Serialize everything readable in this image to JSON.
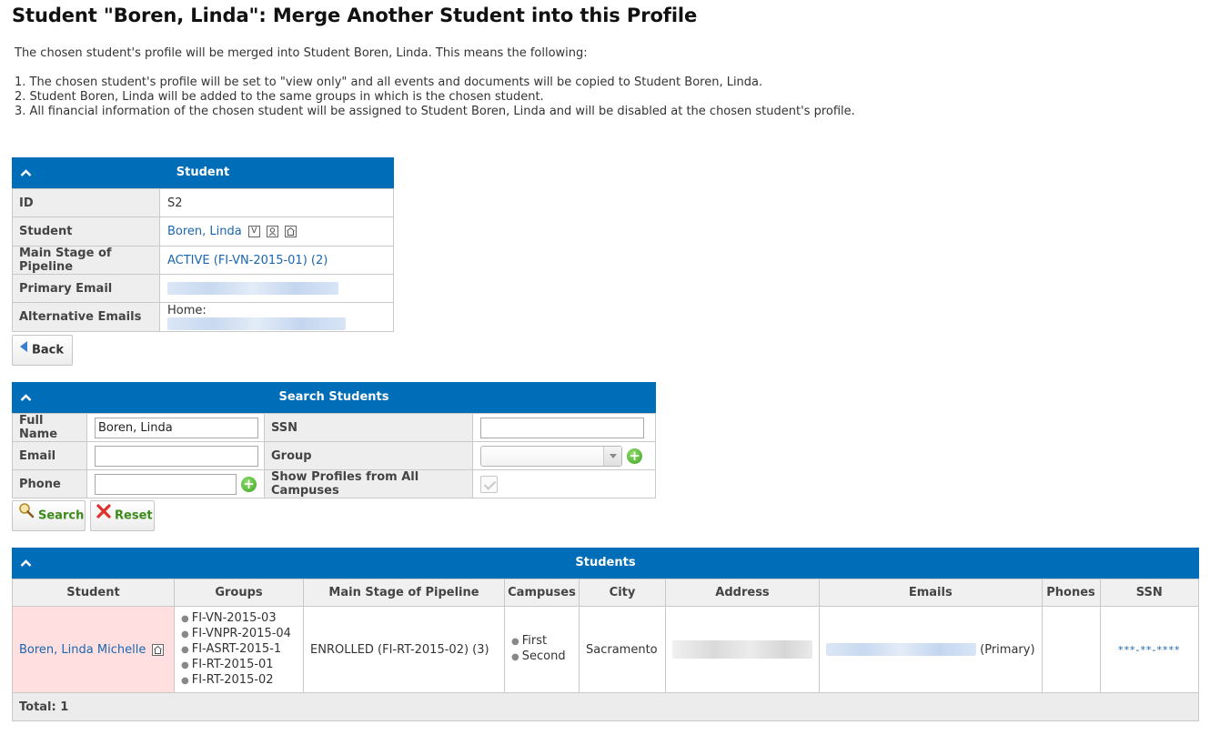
{
  "page_title": "Student \"Boren, Linda\": Merge Another Student into this Profile",
  "intro": {
    "lead": "The chosen student's profile will be merged into Student Boren, Linda. This means the following:",
    "points": [
      "1. The chosen student's profile will be set to \"view only\" and all events and documents will be copied to Student Boren, Linda.",
      "2. Student Boren, Linda will be added to the same groups in which is the chosen student.",
      "3. All financial information of the chosen student will be assigned to Student Boren, Linda and will be disabled at the chosen student's profile."
    ]
  },
  "student_panel": {
    "title": "Student",
    "rows": {
      "id": {
        "label": "ID",
        "value": "S2"
      },
      "student": {
        "label": "Student",
        "value": "Boren, Linda",
        "icons": [
          "v-icon",
          "profile-icon",
          "campus-icon"
        ],
        "v_glyph": "V"
      },
      "pipeline": {
        "label": "Main Stage of Pipeline",
        "value": "ACTIVE (FI-VN-2015-01) (2)"
      },
      "primary_email": {
        "label": "Primary Email"
      },
      "alt_emails": {
        "label": "Alternative Emails",
        "prefix": "Home:"
      }
    }
  },
  "back_button": {
    "label": "Back"
  },
  "search_panel": {
    "title": "Search Students",
    "full_name": {
      "label": "Full Name",
      "value": "Boren, Linda"
    },
    "ssn": {
      "label": "SSN",
      "value": ""
    },
    "email": {
      "label": "Email",
      "value": ""
    },
    "group": {
      "label": "Group",
      "value": ""
    },
    "phone": {
      "label": "Phone",
      "value": ""
    },
    "all_campuses": {
      "label": "Show Profiles from All Campuses",
      "checked": true
    }
  },
  "search_button": {
    "label": "Search"
  },
  "reset_button": {
    "label": "Reset"
  },
  "students_panel": {
    "title": "Students",
    "columns": [
      "Student",
      "Groups",
      "Main Stage of Pipeline",
      "Campuses",
      "City",
      "Address",
      "Emails",
      "Phones",
      "SSN"
    ],
    "rows": [
      {
        "student": "Boren, Linda Michelle",
        "groups": [
          "FI-VN-2015-03",
          "FI-VNPR-2015-04",
          "FI-ASRT-2015-1",
          "FI-RT-2015-01",
          "FI-RT-2015-02"
        ],
        "pipeline": "ENROLLED (FI-RT-2015-02) (3)",
        "campuses": [
          "First",
          "Second"
        ],
        "city": "Sacramento",
        "email_suffix": "(Primary)",
        "phones": "",
        "ssn": "***-**-****"
      }
    ],
    "total": "Total: 1"
  },
  "colors": {
    "header_blue": "#006db8",
    "link_blue": "#1a66b0",
    "highlight_row": "#ffdfdf",
    "add_green": "#3fa522"
  }
}
